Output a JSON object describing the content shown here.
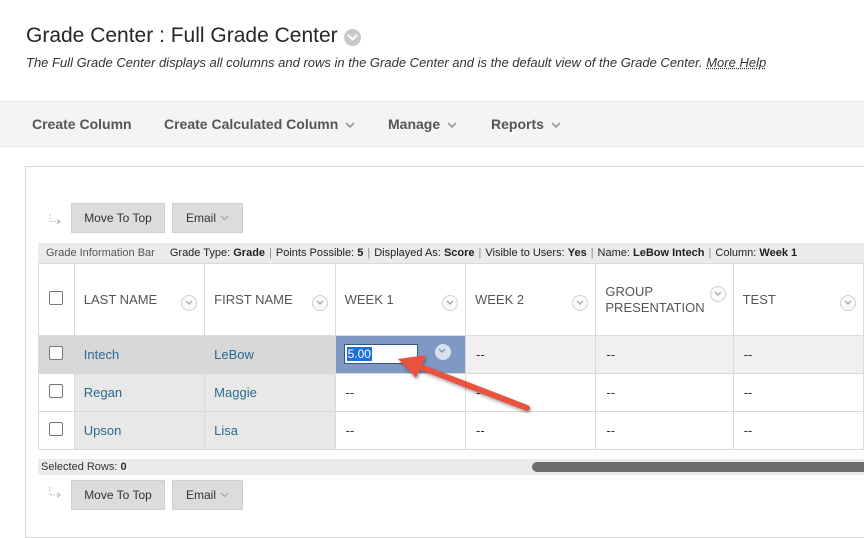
{
  "header": {
    "title": "Grade Center : Full Grade Center",
    "description": "The Full Grade Center displays all columns and rows in the Grade Center and is the default view of the Grade Center.",
    "more_help": "More Help"
  },
  "actionbar": {
    "create_column": "Create Column",
    "create_calculated_column": "Create Calculated Column",
    "manage": "Manage",
    "reports": "Reports"
  },
  "top_buttons": {
    "move_to_top": "Move To Top",
    "email": "Email"
  },
  "bottom_buttons": {
    "move_to_top": "Move To Top",
    "email": "Email"
  },
  "info_bar": {
    "label": "Grade Information Bar",
    "grade_type_label": "Grade Type:",
    "grade_type": "Grade",
    "points_label": "Points Possible:",
    "points": "5",
    "displayed_label": "Displayed As:",
    "displayed": "Score",
    "visible_label": "Visible to Users:",
    "visible": "Yes",
    "name_label": "Name:",
    "name": "LeBow Intech",
    "column_label": "Column:",
    "column": "Week 1"
  },
  "grid": {
    "columns": [
      "LAST NAME",
      "FIRST NAME",
      "WEEK 1",
      "WEEK 2",
      "GROUP PRESENTATION",
      "TEST"
    ],
    "rows": [
      {
        "last": "Intech",
        "first": "LeBow",
        "week1": "5.00",
        "week2": "--",
        "group": "--",
        "test": "--"
      },
      {
        "last": "Regan",
        "first": "Maggie",
        "week1": "--",
        "week2": "--",
        "group": "--",
        "test": "--"
      },
      {
        "last": "Upson",
        "first": "Lisa",
        "week1": "--",
        "week2": "--",
        "group": "--",
        "test": "--"
      }
    ]
  },
  "footer": {
    "selected_rows_label": "Selected Rows:",
    "selected_rows": "0"
  },
  "colors": {
    "accent_arrow": "#e8523f",
    "active_cell": "#7d99c4",
    "link": "#2b6a8f"
  }
}
